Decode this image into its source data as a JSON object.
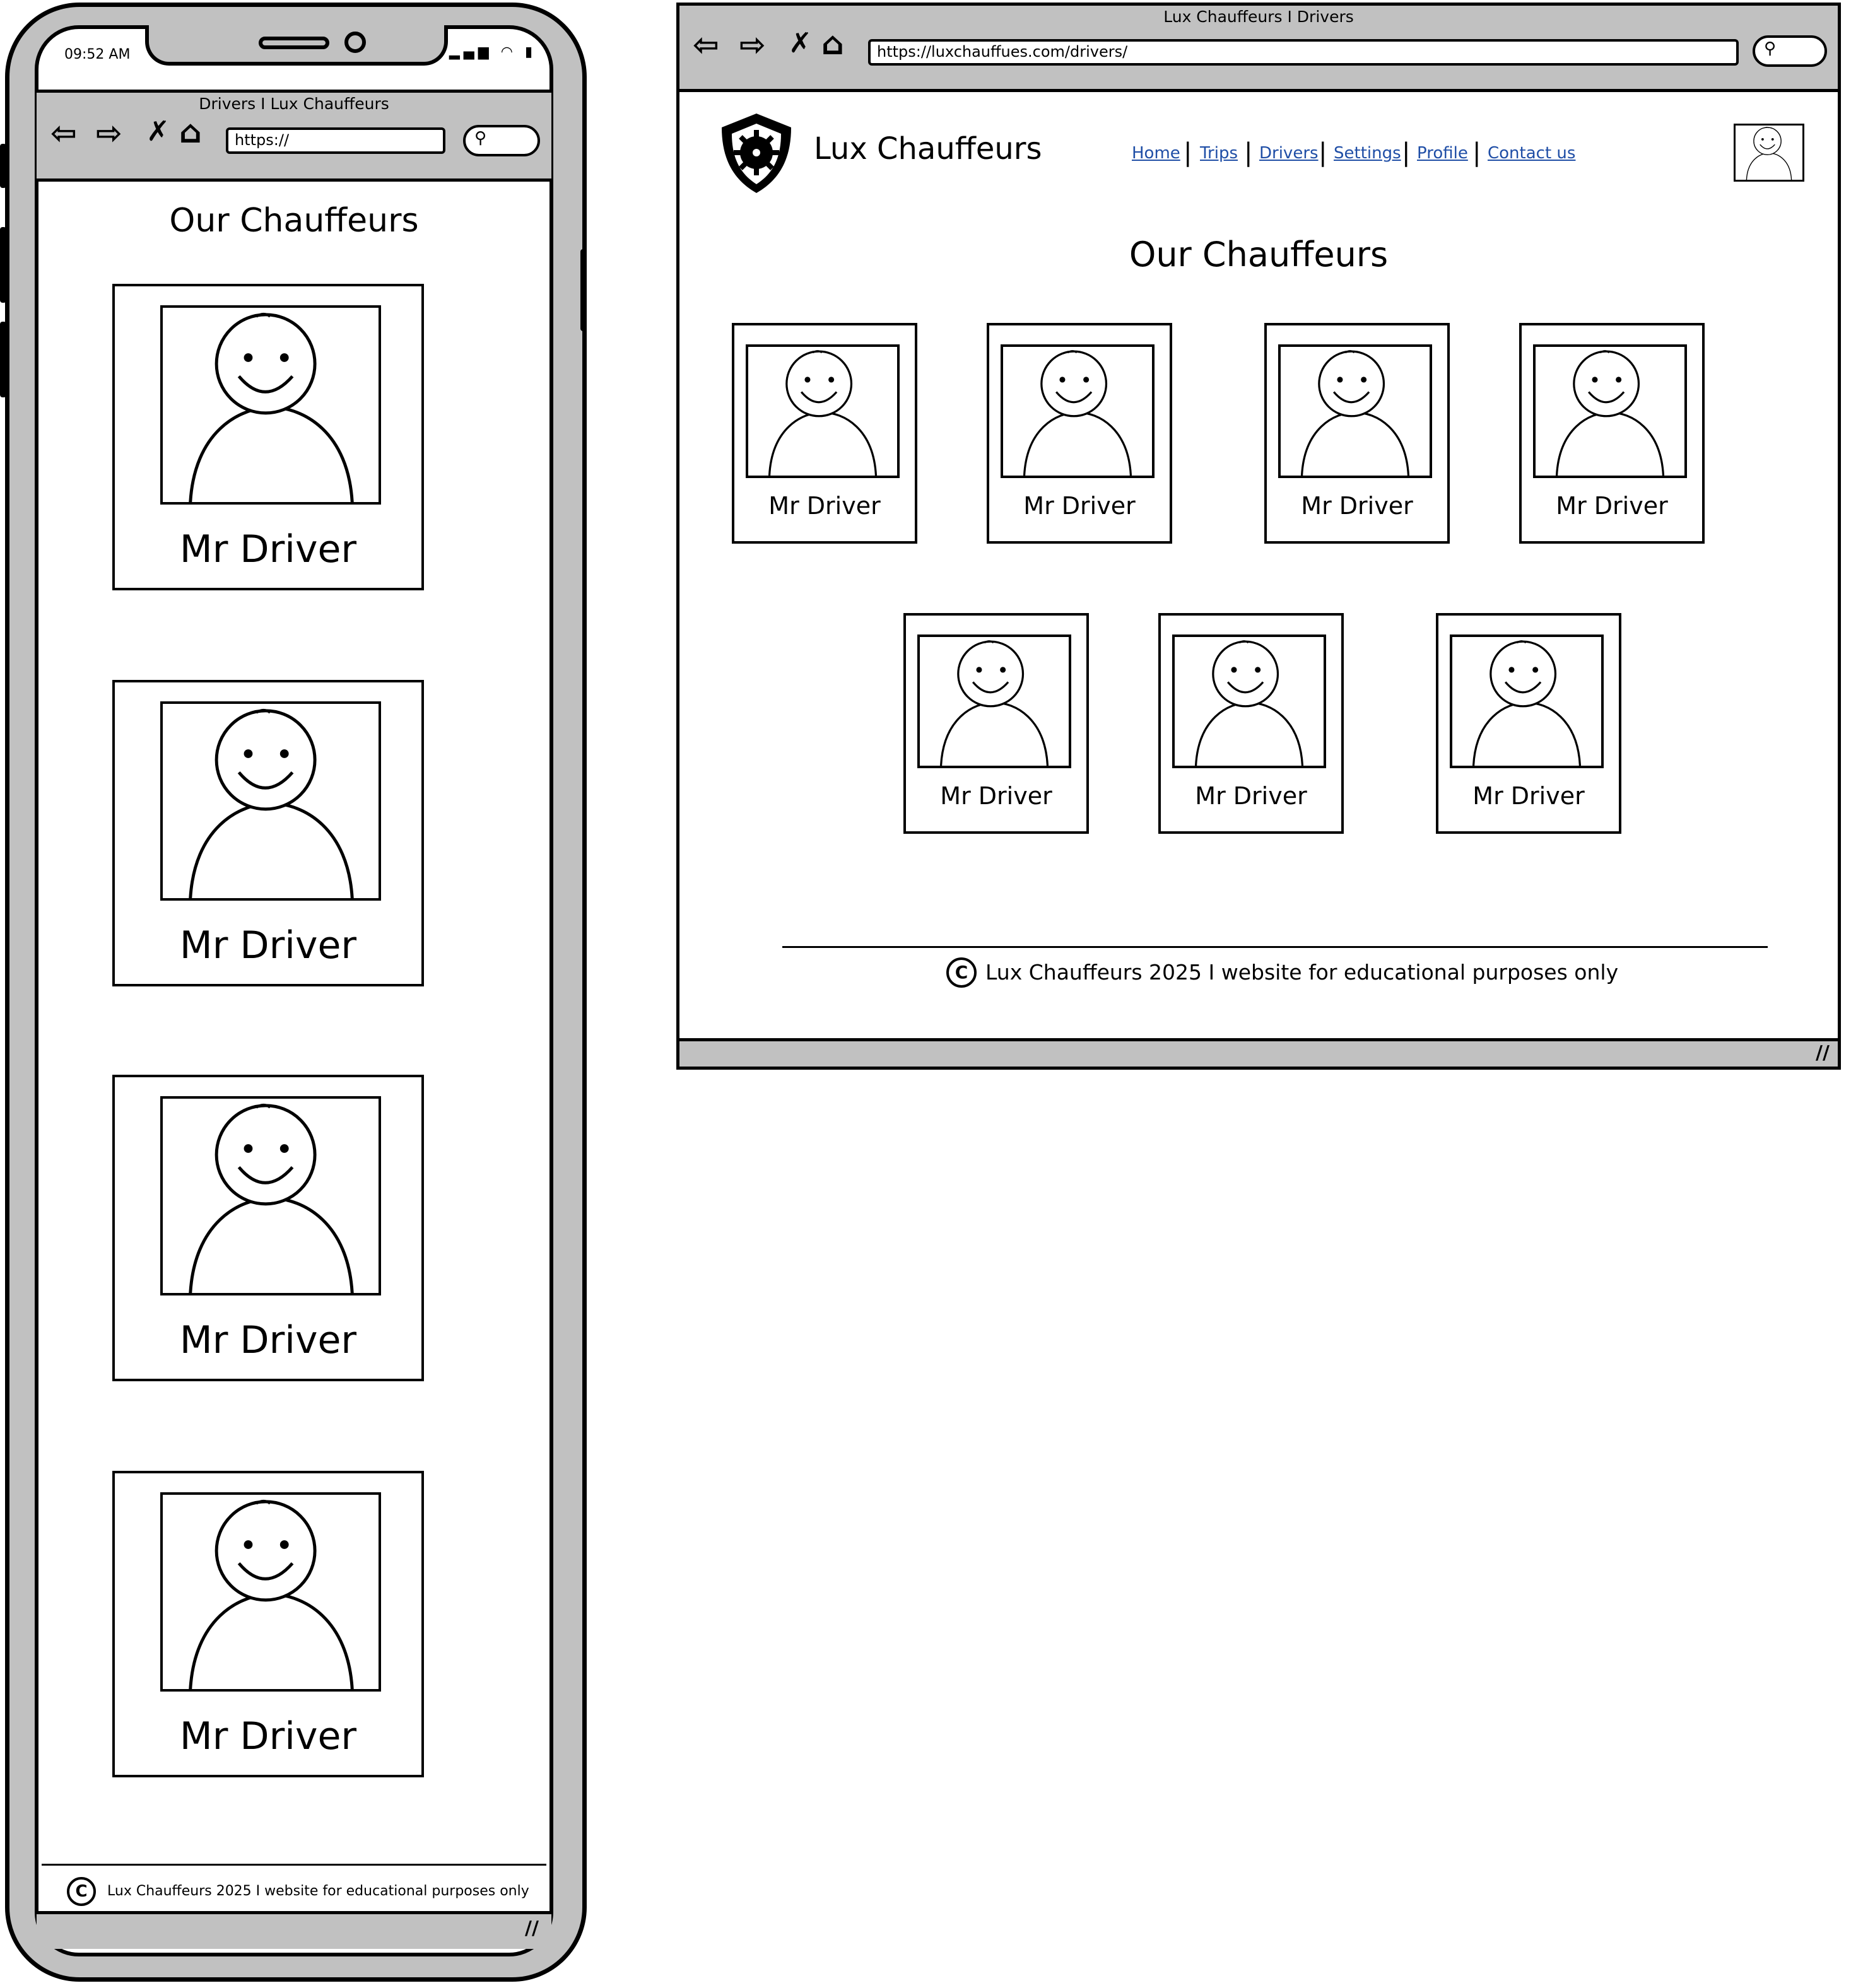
{
  "mobile": {
    "status_time": "09:52 AM",
    "status_icons": "▂▄▆ ◠ ▮",
    "browser": {
      "title": "Drivers I Lux Chauffeurs",
      "url": "https://",
      "back_icon": "⇦",
      "forward_icon": "⇨",
      "stop_icon": "✗",
      "home_icon": "⌂",
      "search_icon": "⚲"
    },
    "page_title": "Our Chauffeurs",
    "drivers": [
      {
        "name": "Mr Driver"
      },
      {
        "name": "Mr Driver"
      },
      {
        "name": "Mr Driver"
      },
      {
        "name": "Mr Driver"
      }
    ],
    "footer": {
      "copyright_symbol": "C",
      "text": "Lux Chauffeurs 2025 I website for educational purposes only"
    },
    "resize_icon": "∕∕"
  },
  "desktop": {
    "browser": {
      "title": "Lux Chauffeurs I Drivers",
      "url": "https://luxchauffues.com/drivers/",
      "back_icon": "⇦",
      "forward_icon": "⇨",
      "stop_icon": "✗",
      "home_icon": "⌂",
      "search_icon": "⚲"
    },
    "brand": "Lux Chauffeurs",
    "nav": {
      "items": [
        {
          "label": "Home"
        },
        {
          "label": "Trips"
        },
        {
          "label": "Drivers"
        },
        {
          "label": "Settings"
        },
        {
          "label": "Profile"
        },
        {
          "label": "Contact us"
        }
      ],
      "link_color": "#1f4ea6"
    },
    "page_title": "Our Chauffeurs",
    "drivers": [
      {
        "name": "Mr Driver"
      },
      {
        "name": "Mr Driver"
      },
      {
        "name": "Mr Driver"
      },
      {
        "name": "Mr Driver"
      },
      {
        "name": "Mr Driver"
      },
      {
        "name": "Mr Driver"
      },
      {
        "name": "Mr Driver"
      }
    ],
    "footer": {
      "copyright_symbol": "C",
      "text": "Lux Chauffeurs 2025 I website for educational purposes only"
    },
    "resize_icon": "∕∕"
  },
  "colors": {
    "chrome_gray": "#c1c1c1",
    "link_blue": "#1f4ea6"
  }
}
